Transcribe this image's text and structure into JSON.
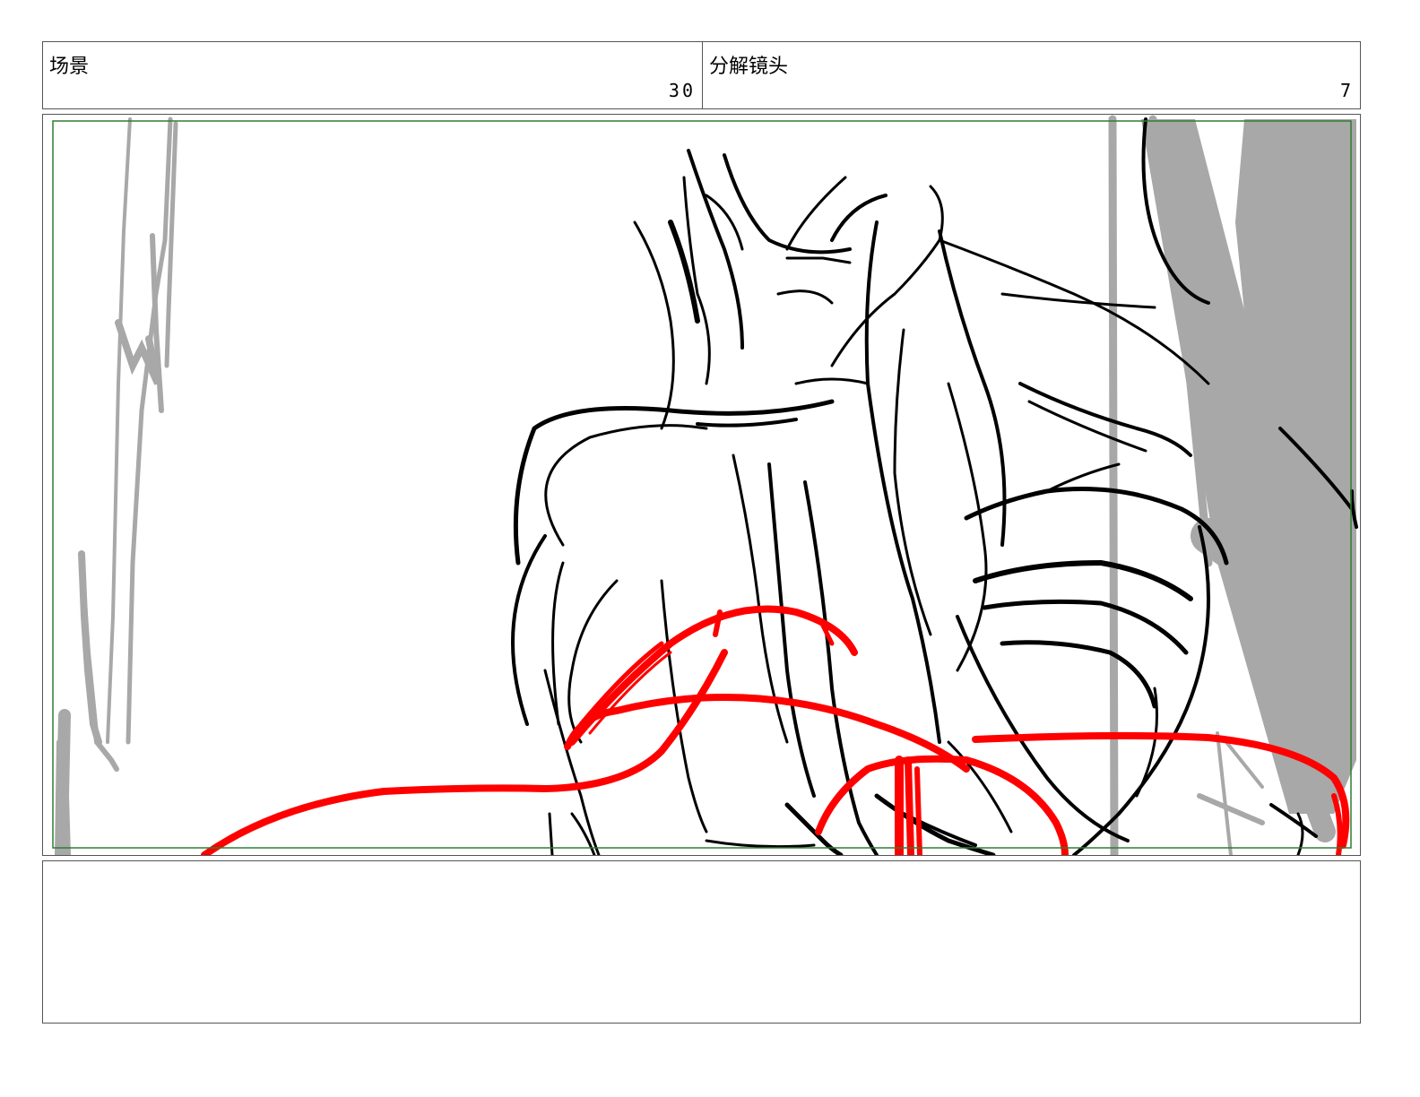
{
  "header": {
    "scene_label": "场景",
    "scene_number": "30",
    "shot_label": "分解镜头",
    "shot_number": "7"
  },
  "panel": {
    "sketch_colors": {
      "ink": "#000000",
      "accent": "#ff0000",
      "tone": "#a8a8a8",
      "frame": "#2e7d32"
    }
  },
  "notes": {
    "text": ""
  }
}
